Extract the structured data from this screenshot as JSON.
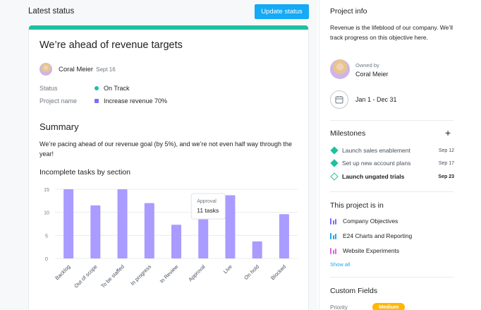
{
  "left_header": {
    "title": "Latest status",
    "update_button": "Update status"
  },
  "status_card": {
    "title": "We’re ahead of revenue targets",
    "author": {
      "name": "Coral Meier",
      "date": "Sept 16"
    },
    "fields": [
      {
        "label": "Status",
        "value": "On Track",
        "indicator_color": "#1fc0a0"
      },
      {
        "label": "Project name",
        "value": "Increase revenue 70%",
        "indicator_color": "#796eff"
      }
    ],
    "summary_heading": "Summary",
    "summary_text": "We’re pacing ahead of our revenue goal (by 5%), and we’re not even half way through the year!",
    "chart_heading": "Incomplete tasks by section"
  },
  "chart_data": {
    "type": "bar",
    "title": "Incomplete tasks by section",
    "categories": [
      "Backlog",
      "Out of scope",
      "To be staffed",
      "In progress",
      "In Review",
      "Approval",
      "Live",
      "On hold",
      "Blocked"
    ],
    "values": [
      15,
      11.5,
      15,
      12,
      7.3,
      11,
      13.7,
      3.7,
      9.6
    ],
    "ylim": [
      0,
      15
    ],
    "yticks": [
      "0",
      "5",
      "10",
      "15"
    ],
    "grid": true,
    "tooltip": {
      "category": "Approval",
      "label": "Approval",
      "value_text": "11 tasks"
    },
    "bar_color": "#a99bff"
  },
  "project_info": {
    "title": "Project info",
    "description": "Revenue is the lifeblood of our company. We’ll track progress on this objective here.",
    "owner_label": "Owned by",
    "owner_name": "Coral Meier",
    "date_range": "Jan 1 - Dec 31"
  },
  "milestones": {
    "title": "Milestones",
    "add_symbol": "+",
    "items": [
      {
        "label": "Launch sales enablement",
        "date": "Sep 12",
        "done": true
      },
      {
        "label": "Set up new account plans",
        "date": "Sep 17",
        "done": true
      },
      {
        "label": "Launch ungated trials",
        "date": "Sep 23",
        "done": false
      }
    ]
  },
  "projects": {
    "title": "This project is in",
    "items": [
      {
        "label": "Company Objectives",
        "color": "#796eff"
      },
      {
        "label": "E24 Charts and Reporting",
        "color": "#14aaf5"
      },
      {
        "label": "Website Experiments",
        "color": "#e362e3"
      }
    ],
    "show_all": "Show all"
  },
  "custom_fields": {
    "title": "Custom Fields",
    "priority_label": "Priority",
    "priority_value": "Medium"
  }
}
